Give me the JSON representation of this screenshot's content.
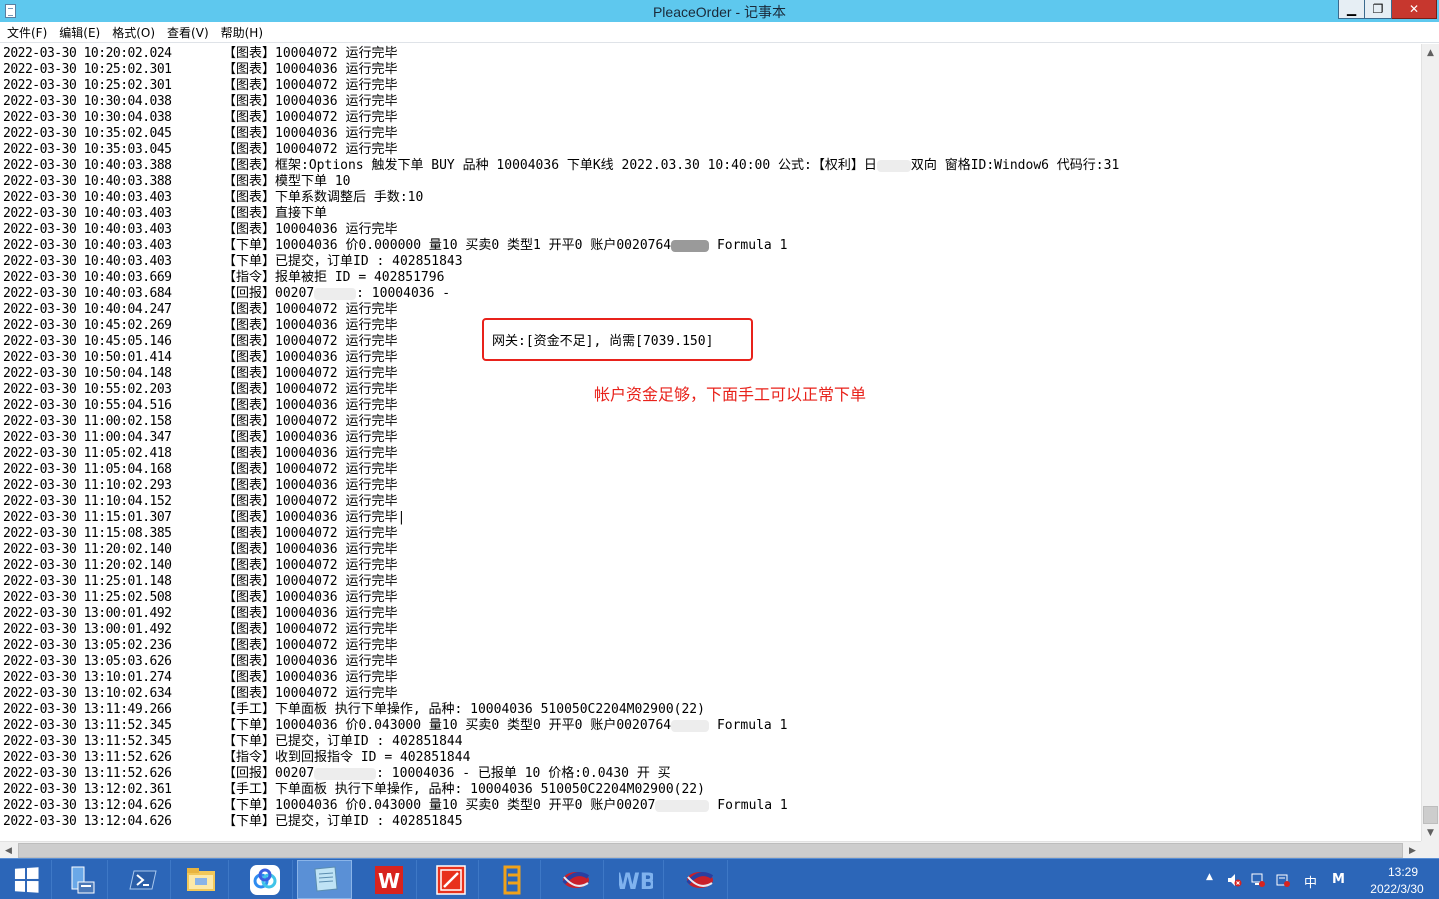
{
  "window": {
    "title": "PleaceOrder - 记事本",
    "minimize_glyph": "▁",
    "maximize_glyph": "❐",
    "close_glyph": "✕"
  },
  "menu": [
    "文件(F)",
    "编辑(E)",
    "格式(O)",
    "查看(V)",
    "帮助(H)"
  ],
  "log": [
    {
      "t": "2022-03-30 10:20:02.024",
      "tag": "【图表】",
      "msg": "10004072 运行完毕"
    },
    {
      "t": "2022-03-30 10:25:02.301",
      "tag": "【图表】",
      "msg": "10004036 运行完毕"
    },
    {
      "t": "2022-03-30 10:25:02.301",
      "tag": "【图表】",
      "msg": "10004072 运行完毕"
    },
    {
      "t": "2022-03-30 10:30:04.038",
      "tag": "【图表】",
      "msg": "10004036 运行完毕"
    },
    {
      "t": "2022-03-30 10:30:04.038",
      "tag": "【图表】",
      "msg": "10004072 运行完毕"
    },
    {
      "t": "2022-03-30 10:35:02.045",
      "tag": "【图表】",
      "msg": "10004036 运行完毕"
    },
    {
      "t": "2022-03-30 10:35:03.045",
      "tag": "【图表】",
      "msg": "10004072 运行完毕"
    },
    {
      "t": "2022-03-30 10:40:03.388",
      "tag": "【图表】",
      "msg": "框架:Options 触发下单 BUY 品种 10004036 下单K线 2022.03.30 10:40:00 公式:【权利】日",
      "redact": 34,
      "msg2": "双向 窗格ID:Window6 代码行:31"
    },
    {
      "t": "2022-03-30 10:40:03.388",
      "tag": "【图表】",
      "msg": "模型下单 10"
    },
    {
      "t": "2022-03-30 10:40:03.403",
      "tag": "【图表】",
      "msg": "下单系数调整后 手数:10"
    },
    {
      "t": "2022-03-30 10:40:03.403",
      "tag": "【图表】",
      "msg": "直接下单"
    },
    {
      "t": "2022-03-30 10:40:03.403",
      "tag": "【图表】",
      "msg": "10004036 运行完毕"
    },
    {
      "t": "2022-03-30 10:40:03.403",
      "tag": "【下单】",
      "msg": "10004036 价0.000000 量10 买卖0 类型1 开平0 账户0020764",
      "redact": 38,
      "dark": true,
      "msg2": " Formula 1"
    },
    {
      "t": "2022-03-30 10:40:03.403",
      "tag": "【下单】",
      "msg": "已提交，订单ID : 402851843"
    },
    {
      "t": "2022-03-30 10:40:03.669",
      "tag": "【指令】",
      "msg": "报单被拒 ID = 402851796"
    },
    {
      "t": "2022-03-30 10:40:03.684",
      "tag": "【回报】",
      "msg": "00207",
      "redact": 42,
      "msg2": ": 10004036 -"
    },
    {
      "t": "2022-03-30 10:40:04.247",
      "tag": "【图表】",
      "msg": "10004072 运行完毕"
    },
    {
      "t": "2022-03-30 10:45:02.269",
      "tag": "【图表】",
      "msg": "10004036 运行完毕"
    },
    {
      "t": "2022-03-30 10:45:05.146",
      "tag": "【图表】",
      "msg": "10004072 运行完毕"
    },
    {
      "t": "2022-03-30 10:50:01.414",
      "tag": "【图表】",
      "msg": "10004036 运行完毕"
    },
    {
      "t": "2022-03-30 10:50:04.148",
      "tag": "【图表】",
      "msg": "10004072 运行完毕"
    },
    {
      "t": "2022-03-30 10:55:02.203",
      "tag": "【图表】",
      "msg": "10004072 运行完毕"
    },
    {
      "t": "2022-03-30 10:55:04.516",
      "tag": "【图表】",
      "msg": "10004036 运行完毕"
    },
    {
      "t": "2022-03-30 11:00:02.158",
      "tag": "【图表】",
      "msg": "10004072 运行完毕"
    },
    {
      "t": "2022-03-30 11:00:04.347",
      "tag": "【图表】",
      "msg": "10004036 运行完毕"
    },
    {
      "t": "2022-03-30 11:05:02.418",
      "tag": "【图表】",
      "msg": "10004036 运行完毕"
    },
    {
      "t": "2022-03-30 11:05:04.168",
      "tag": "【图表】",
      "msg": "10004072 运行完毕"
    },
    {
      "t": "2022-03-30 11:10:02.293",
      "tag": "【图表】",
      "msg": "10004036 运行完毕"
    },
    {
      "t": "2022-03-30 11:10:04.152",
      "tag": "【图表】",
      "msg": "10004072 运行完毕"
    },
    {
      "t": "2022-03-30 11:15:01.307",
      "tag": "【图表】",
      "msg": "10004036 运行完毕|"
    },
    {
      "t": "2022-03-30 11:15:08.385",
      "tag": "【图表】",
      "msg": "10004072 运行完毕"
    },
    {
      "t": "2022-03-30 11:20:02.140",
      "tag": "【图表】",
      "msg": "10004036 运行完毕"
    },
    {
      "t": "2022-03-30 11:20:02.140",
      "tag": "【图表】",
      "msg": "10004072 运行完毕"
    },
    {
      "t": "2022-03-30 11:25:01.148",
      "tag": "【图表】",
      "msg": "10004072 运行完毕"
    },
    {
      "t": "2022-03-30 11:25:02.508",
      "tag": "【图表】",
      "msg": "10004036 运行完毕"
    },
    {
      "t": "2022-03-30 13:00:01.492",
      "tag": "【图表】",
      "msg": "10004036 运行完毕"
    },
    {
      "t": "2022-03-30 13:00:01.492",
      "tag": "【图表】",
      "msg": "10004072 运行完毕"
    },
    {
      "t": "2022-03-30 13:05:02.236",
      "tag": "【图表】",
      "msg": "10004072 运行完毕"
    },
    {
      "t": "2022-03-30 13:05:03.626",
      "tag": "【图表】",
      "msg": "10004036 运行完毕"
    },
    {
      "t": "2022-03-30 13:10:01.274",
      "tag": "【图表】",
      "msg": "10004036 运行完毕"
    },
    {
      "t": "2022-03-30 13:10:02.634",
      "tag": "【图表】",
      "msg": "10004072 运行完毕"
    },
    {
      "t": "2022-03-30 13:11:49.266",
      "tag": "【手工】",
      "msg": "下单面板 执行下单操作, 品种: 10004036 510050C2204M02900(22)"
    },
    {
      "t": "2022-03-30 13:11:52.345",
      "tag": "【下单】",
      "msg": "10004036 价0.043000 量10 买卖0 类型0 开平0 账户0020764",
      "redact": 38,
      "msg2": " Formula 1"
    },
    {
      "t": "2022-03-30 13:11:52.345",
      "tag": "【下单】",
      "msg": "已提交，订单ID : 402851844"
    },
    {
      "t": "2022-03-30 13:11:52.626",
      "tag": "【指令】",
      "msg": "收到回报指令 ID = 402851844"
    },
    {
      "t": "2022-03-30 13:11:52.626",
      "tag": "【回报】",
      "msg": "00207",
      "redact": 62,
      "msg2": ": 10004036 - 已报单 10 价格:0.0430 开 买"
    },
    {
      "t": "2022-03-30 13:12:02.361",
      "tag": "【手工】",
      "msg": "下单面板 执行下单操作, 品种: 10004036 510050C2204M02900(22)"
    },
    {
      "t": "2022-03-30 13:12:04.626",
      "tag": "【下单】",
      "msg": "10004036 价0.043000 量10 买卖0 类型0 开平0 账户00207",
      "redact": 54,
      "msg2": " Formula 1"
    },
    {
      "t": "2022-03-30 13:12:04.626",
      "tag": "【下单】",
      "msg": "已提交，订单ID : 402851845"
    }
  ],
  "annotation": {
    "box_text": "网关:[资金不足], 尚需[7039.150]",
    "note_text": "帐户资金足够，下面手工可以正常下单",
    "color": "#e8221b"
  },
  "taskbar": {
    "apps": [
      {
        "name": "server-manager-icon"
      },
      {
        "name": "powershell-icon"
      },
      {
        "name": "file-explorer-icon"
      },
      {
        "name": "baidu-netdisk-icon"
      },
      {
        "name": "notepad-icon",
        "active": true
      },
      {
        "name": "wps-writer-icon"
      },
      {
        "name": "pdf-editor-icon"
      },
      {
        "name": "notes-app-icon"
      },
      {
        "name": "trading-terminal-icon"
      },
      {
        "name": "wb-app-icon"
      },
      {
        "name": "trading-terminal-2-icon"
      }
    ],
    "tray": {
      "ime_label": "中",
      "ime_mode": "M",
      "time": "13:29",
      "date": "2022/3/30"
    }
  }
}
